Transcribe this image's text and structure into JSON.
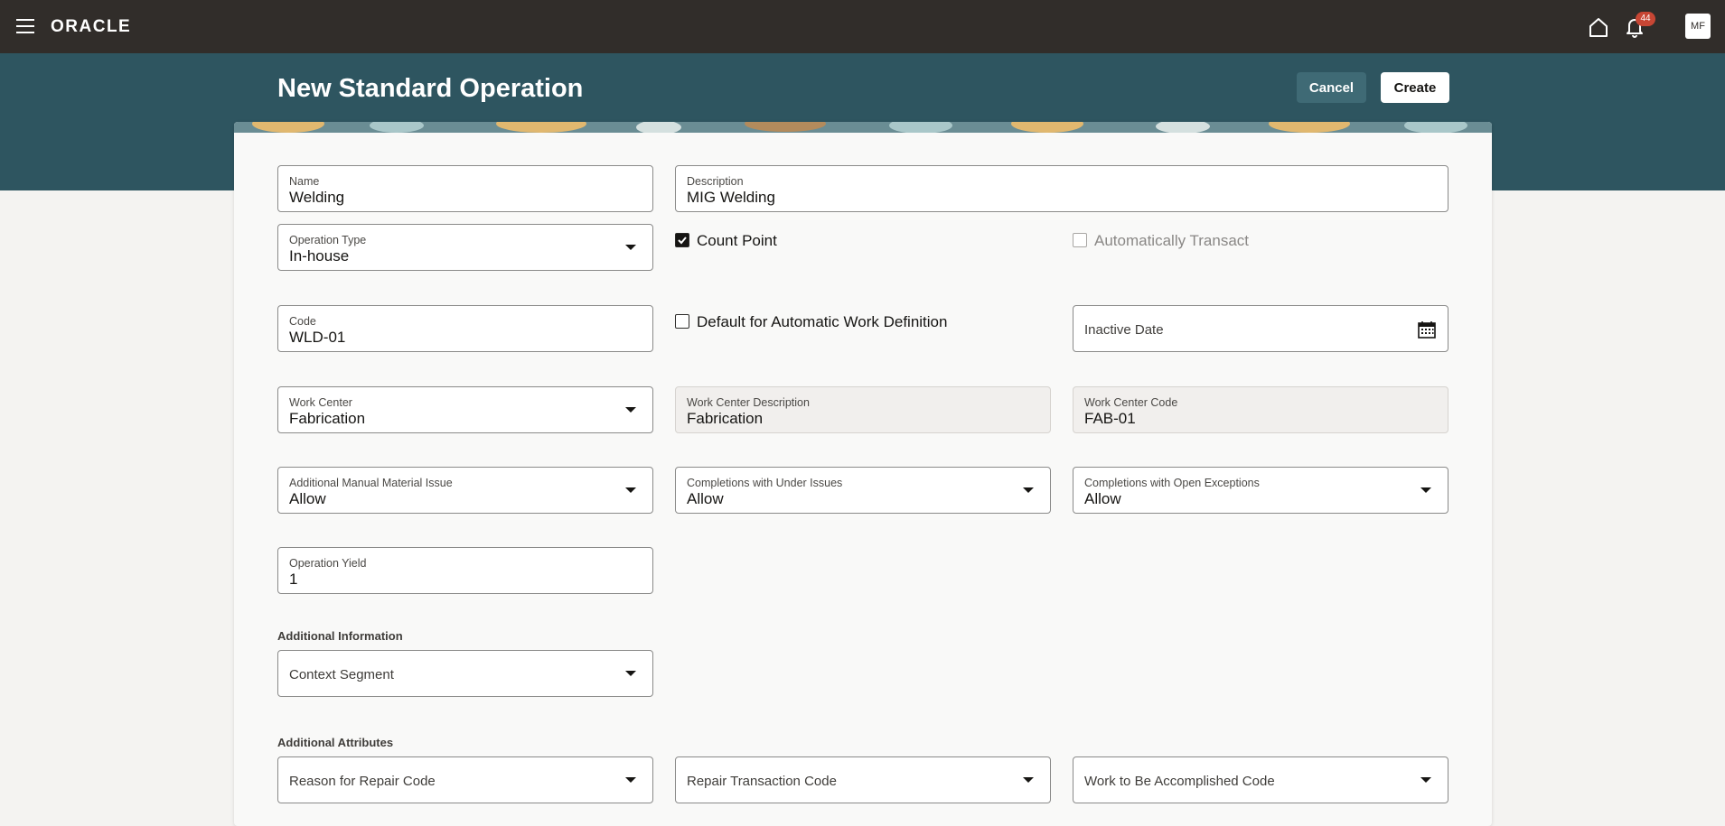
{
  "header": {
    "brand": "ORACLE",
    "notification_count": "44",
    "user_initials": "MF"
  },
  "page": {
    "title": "New Standard Operation",
    "cancel_label": "Cancel",
    "create_label": "Create"
  },
  "form": {
    "name": {
      "label": "Name",
      "value": "Welding"
    },
    "description": {
      "label": "Description",
      "value": "MIG Welding"
    },
    "operation_type": {
      "label": "Operation Type",
      "value": "In-house"
    },
    "count_point": {
      "label": "Count Point",
      "checked": true
    },
    "automatically_transact": {
      "label": "Automatically Transact",
      "checked": false,
      "disabled": true
    },
    "code": {
      "label": "Code",
      "value": "WLD-01"
    },
    "default_auto_work_def": {
      "label": "Default for Automatic Work Definition",
      "checked": false
    },
    "inactive_date": {
      "label": "Inactive Date",
      "value": ""
    },
    "work_center": {
      "label": "Work Center",
      "value": "Fabrication"
    },
    "work_center_description": {
      "label": "Work Center Description",
      "value": "Fabrication"
    },
    "work_center_code": {
      "label": "Work Center Code",
      "value": "FAB-01"
    },
    "additional_manual_material_issue": {
      "label": "Additional Manual Material Issue",
      "value": "Allow"
    },
    "completions_under_issues": {
      "label": "Completions with Under Issues",
      "value": "Allow"
    },
    "completions_open_exceptions": {
      "label": "Completions with Open Exceptions",
      "value": "Allow"
    },
    "operation_yield": {
      "label": "Operation Yield",
      "value": "1"
    }
  },
  "additional_information": {
    "title": "Additional Information",
    "context_segment": "Context Segment"
  },
  "additional_attributes": {
    "title": "Additional Attributes",
    "reason_for_repair_code": "Reason for Repair Code",
    "repair_transaction_code": "Repair Transaction Code",
    "work_to_be_accomplished_code": "Work to Be Accomplished Code"
  },
  "icons": {
    "menu": "hamburger-icon",
    "home": "home-icon",
    "notifications": "bell-icon",
    "calendar": "calendar-icon",
    "dropdown": "chevron-down-icon"
  },
  "colors": {
    "topbar": "#312d2a",
    "banner": "#2e5560",
    "badge": "#c74634",
    "cancel_button": "#3f6a75"
  }
}
